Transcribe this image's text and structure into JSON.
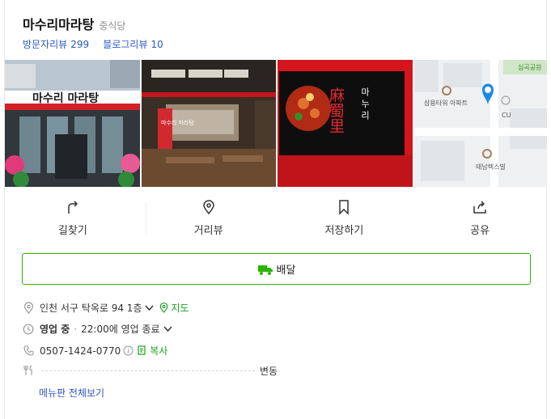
{
  "place": {
    "name": "마수리마라탕",
    "category": "중식당"
  },
  "reviews": {
    "visitor_label": "방문자리뷰",
    "visitor_count": "299",
    "blog_label": "블로그리뷰",
    "blog_count": "10"
  },
  "photos": [
    {
      "sign_text": "마수리 마라탕"
    },
    {
      "sign_text": "마수리 마라탕"
    },
    {
      "sign_text": "麻蜀里",
      "side_text": "마 누 리"
    },
    {
      "map_labels": [
        "삼용타워 아파트",
        "CU",
        "태남렉스빌",
        "심곡공원"
      ]
    }
  ],
  "actions": [
    {
      "label": "길찾기",
      "icon": "directions-icon"
    },
    {
      "label": "거리뷰",
      "icon": "map-pin-icon"
    },
    {
      "label": "저장하기",
      "icon": "bookmark-icon"
    },
    {
      "label": "공유",
      "icon": "share-icon"
    }
  ],
  "delivery": {
    "label": "배달",
    "icon": "delivery-truck-icon"
  },
  "info": {
    "address": "인천 서구 탁옥로 94 1층",
    "map_link": "지도",
    "status": "영업 중",
    "separator": "·",
    "hours": "22:00에 영업 종료",
    "phone": "0507-1424-0770",
    "copy_label": "복사",
    "menu_price": "변동",
    "menu_all": "메뉴판 전체보기"
  },
  "colors": {
    "accent_green": "#17a21e",
    "link_blue": "#2d57c8",
    "pin_blue": "#1e88e5"
  }
}
